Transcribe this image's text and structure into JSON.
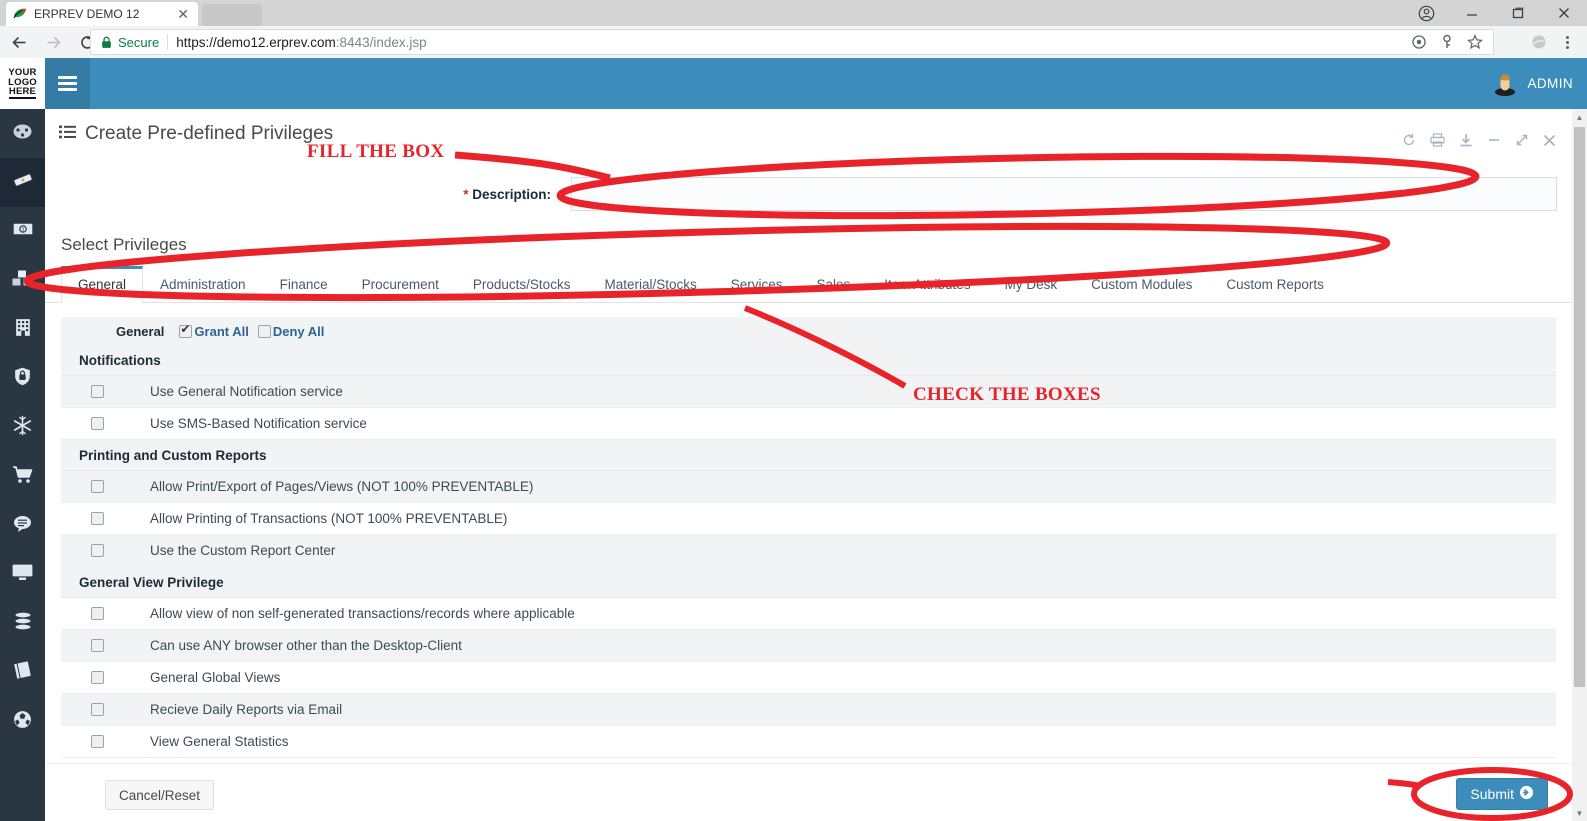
{
  "browser": {
    "tab_title": "ERPREV DEMO 12",
    "tab_close": "✕",
    "favicon": "erprev-leaf-icon",
    "back": "←",
    "forward": "→",
    "reload": "⟳",
    "security_label": "Secure",
    "url_scheme": "https://",
    "url_host": "demo12.erprev.com",
    "url_tail": ":8443/index.jsp",
    "window_minimize": "—",
    "window_maximize": "❐",
    "window_close": "✕",
    "omni_icons": [
      "location-target-icon",
      "key-icon",
      "bookmark-star-icon"
    ],
    "extension_icon": "extension-globe-icon",
    "menu_icon": "chrome-menu-icon"
  },
  "sidebar": {
    "logo": {
      "line1": "YOUR",
      "line2": "LOGO",
      "line3": "HERE"
    },
    "items": [
      {
        "name": "dashboard",
        "icon": "speedometer-icon",
        "active": false
      },
      {
        "name": "tickets",
        "icon": "ticket-icon",
        "active": true
      },
      {
        "name": "finance",
        "icon": "banknote-icon",
        "active": false
      },
      {
        "name": "products",
        "icon": "boxes-icon",
        "active": false
      },
      {
        "name": "company",
        "icon": "building-icon",
        "active": false
      },
      {
        "name": "security",
        "icon": "shield-lock-icon",
        "active": false
      },
      {
        "name": "cold-chain",
        "icon": "snowflake-icon",
        "active": false
      },
      {
        "name": "sales",
        "icon": "shopping-cart-icon",
        "active": false
      },
      {
        "name": "services",
        "icon": "chat-bubble-icon",
        "active": false
      },
      {
        "name": "my-desk",
        "icon": "monitor-icon",
        "active": false
      },
      {
        "name": "database",
        "icon": "database-stack-icon",
        "active": false
      },
      {
        "name": "reports",
        "icon": "book-icon",
        "active": false
      },
      {
        "name": "global",
        "icon": "globe-icon",
        "active": false
      }
    ]
  },
  "topbar": {
    "menu_toggle": "hamburger-icon",
    "user_label": "ADMIN",
    "avatar": "user-avatar-icon"
  },
  "page": {
    "title": "Create Pre-defined Privileges",
    "title_icon": "list-icon",
    "tools": [
      {
        "name": "refresh",
        "glyph": "⟳"
      },
      {
        "name": "print",
        "glyph": "printer"
      },
      {
        "name": "download",
        "glyph": "download"
      },
      {
        "name": "minimize",
        "glyph": "–"
      },
      {
        "name": "expand",
        "glyph": "⤢"
      },
      {
        "name": "close",
        "glyph": "✕"
      }
    ]
  },
  "form": {
    "description_label": "Description:",
    "required_marker": "*",
    "description_value": "",
    "description_placeholder": ""
  },
  "privileges": {
    "section_title": "Select Privileges",
    "tabs": [
      {
        "label": "General",
        "active": true
      },
      {
        "label": "Administration",
        "active": false
      },
      {
        "label": "Finance",
        "active": false
      },
      {
        "label": "Procurement",
        "active": false
      },
      {
        "label": "Products/Stocks",
        "active": false
      },
      {
        "label": "Material/Stocks",
        "active": false
      },
      {
        "label": "Services",
        "active": false
      },
      {
        "label": "Sales",
        "active": false
      },
      {
        "label": "Item Attributes",
        "active": false
      },
      {
        "label": "My Desk",
        "active": false
      },
      {
        "label": "Custom Modules",
        "active": false
      },
      {
        "label": "Custom Reports",
        "active": false
      }
    ],
    "header": {
      "group_label": "General",
      "grant_all_label": "Grant All",
      "grant_all_checked": true,
      "deny_all_label": "Deny All",
      "deny_all_checked": false
    },
    "groups": [
      {
        "title": "Notifications",
        "rows": [
          {
            "label": "Use General Notification service",
            "checked": false
          },
          {
            "label": "Use SMS-Based Notification service",
            "checked": false
          }
        ]
      },
      {
        "title": "Printing and Custom Reports",
        "rows": [
          {
            "label": "Allow Print/Export of Pages/Views (NOT 100% PREVENTABLE)",
            "checked": false
          },
          {
            "label": "Allow Printing of Transactions (NOT 100% PREVENTABLE)",
            "checked": false
          },
          {
            "label": "Use the Custom Report Center",
            "checked": false
          }
        ]
      },
      {
        "title": "General View Privilege",
        "rows": [
          {
            "label": "Allow view of non self-generated transactions/records where applicable",
            "checked": false
          },
          {
            "label": "Can use ANY browser other than the Desktop-Client",
            "checked": false
          },
          {
            "label": "General Global Views",
            "checked": false
          },
          {
            "label": "Recieve Daily Reports via Email",
            "checked": false
          },
          {
            "label": "View General Statistics",
            "checked": false
          }
        ]
      }
    ]
  },
  "footer": {
    "cancel_label": "Cancel/Reset",
    "submit_label": "Submit",
    "submit_icon": "arrow-right-circle-icon"
  },
  "annotations": {
    "color": "#e8232a",
    "fill_the_box": "FILL THE BOX",
    "check_the_boxes": "CHECK THE BOXES"
  }
}
